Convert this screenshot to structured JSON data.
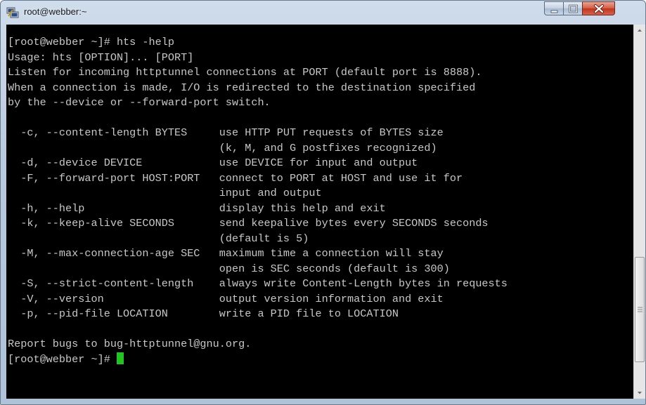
{
  "window": {
    "title": "root@webber:~"
  },
  "terminal": {
    "lines": [
      "[root@webber ~]# hts -help",
      "Usage: hts [OPTION]... [PORT]",
      "Listen for incoming httptunnel connections at PORT (default port is 8888).",
      "When a connection is made, I/O is redirected to the destination specified",
      "by the --device or --forward-port switch.",
      "",
      "  -c, --content-length BYTES     use HTTP PUT requests of BYTES size",
      "                                 (k, M, and G postfixes recognized)",
      "  -d, --device DEVICE            use DEVICE for input and output",
      "  -F, --forward-port HOST:PORT   connect to PORT at HOST and use it for",
      "                                 input and output",
      "  -h, --help                     display this help and exit",
      "  -k, --keep-alive SECONDS       send keepalive bytes every SECONDS seconds",
      "                                 (default is 5)",
      "  -M, --max-connection-age SEC   maximum time a connection will stay",
      "                                 open is SEC seconds (default is 300)",
      "  -S, --strict-content-length    always write Content-Length bytes in requests",
      "  -V, --version                  output version information and exit",
      "  -p, --pid-file LOCATION        write a PID file to LOCATION",
      "",
      "Report bugs to bug-httptunnel@gnu.org."
    ],
    "prompt": "[root@webber ~]# ",
    "cursor_color": "#22c422"
  },
  "icons": {
    "app": "putty-icon",
    "minimize": "minimize-icon",
    "maximize": "maximize-icon",
    "close": "close-icon",
    "scroll_up": "arrow-up-icon",
    "scroll_down": "arrow-down-icon"
  },
  "scrollbar": {
    "position": 0.9
  }
}
